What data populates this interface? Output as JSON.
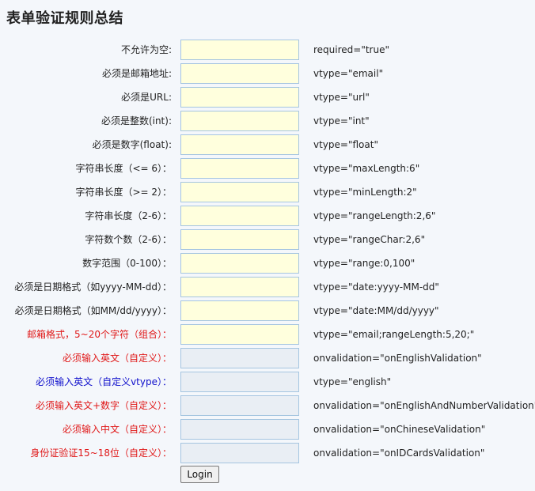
{
  "page": {
    "title": "表单验证规则总结"
  },
  "rows": [
    {
      "label": "不允许为空:",
      "rule": "required=\"true\"",
      "color": "#222222",
      "field": "req"
    },
    {
      "label": "必须是邮箱地址:",
      "rule": "vtype=\"email\"",
      "color": "#222222",
      "field": "req"
    },
    {
      "label": "必须是URL:",
      "rule": "vtype=\"url\"",
      "color": "#222222",
      "field": "req"
    },
    {
      "label": "必须是整数(int):",
      "rule": "vtype=\"int\"",
      "color": "#222222",
      "field": "req"
    },
    {
      "label": "必须是数字(float):",
      "rule": "vtype=\"float\"",
      "color": "#222222",
      "field": "req"
    },
    {
      "label": "字符串长度（<= 6）：",
      "rule": "vtype=\"maxLength:6\"",
      "color": "#222222",
      "field": "req"
    },
    {
      "label": "字符串长度（>= 2）：",
      "rule": "vtype=\"minLength:2\"",
      "color": "#222222",
      "field": "req"
    },
    {
      "label": "字符串长度（2-6）：",
      "rule": "vtype=\"rangeLength:2,6\"",
      "color": "#222222",
      "field": "req"
    },
    {
      "label": "字符数个数（2-6）：",
      "rule": "vtype=\"rangeChar:2,6\"",
      "color": "#222222",
      "field": "req"
    },
    {
      "label": "数字范围（0-100）：",
      "rule": "vtype=\"range:0,100\"",
      "color": "#222222",
      "field": "req"
    },
    {
      "label": "必须是日期格式（如yyyy-MM-dd）：",
      "rule": "vtype=\"date:yyyy-MM-dd\"",
      "color": "#222222",
      "field": "req"
    },
    {
      "label": "必须是日期格式（如MM/dd/yyyy）：",
      "rule": "vtype=\"date:MM/dd/yyyy\"",
      "color": "#222222",
      "field": "req"
    },
    {
      "label": "邮箱格式，5~20个字符（组合）：",
      "rule": "vtype=\"email;rangeLength:5,20;\"",
      "color": "#e01818",
      "field": "req"
    },
    {
      "label": "必须输入英文（自定义）：",
      "rule": "onvalidation=\"onEnglishValidation\"",
      "color": "#e01818",
      "field": "opt"
    },
    {
      "label": "必须输入英文（自定义vtype）：",
      "rule": "vtype=\"english\"",
      "color": "#1010cc",
      "field": "opt"
    },
    {
      "label": "必须输入英文+数字（自定义）：",
      "rule": "onvalidation=\"onEnglishAndNumberValidation\"",
      "color": "#e01818",
      "field": "opt"
    },
    {
      "label": "必须输入中文（自定义）：",
      "rule": "onvalidation=\"onChineseValidation\"",
      "color": "#e01818",
      "field": "opt"
    },
    {
      "label": "身份证验证15~18位（自定义）：",
      "rule": "onvalidation=\"onIDCardsValidation\"",
      "color": "#e01818",
      "field": "opt"
    }
  ],
  "login_button": {
    "label": "Login"
  }
}
